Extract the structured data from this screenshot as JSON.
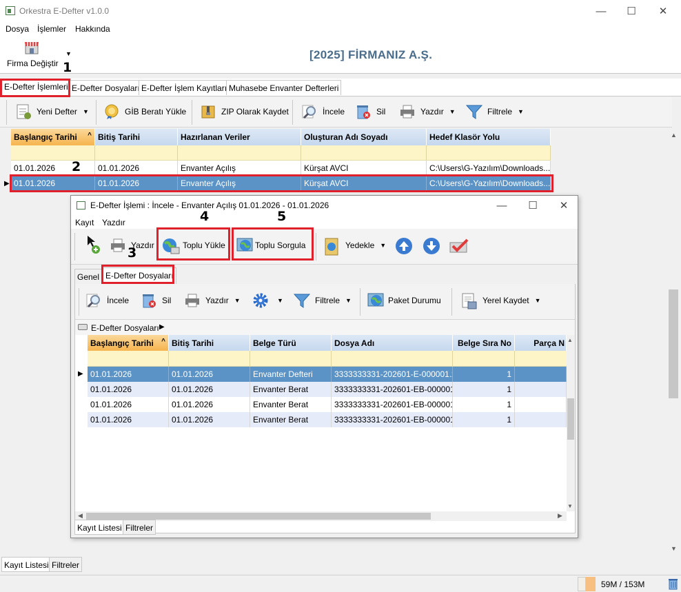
{
  "window": {
    "title": "Orkestra E-Defter v1.0.0",
    "min": "—",
    "max": "☐",
    "close": "✕"
  },
  "menu": [
    "Dosya",
    "İşlemler",
    "Hakkında"
  ],
  "company": {
    "switch_label": "Firma Değiştir",
    "name": "[2025] FİRMANIZ A.Ş."
  },
  "main_tabs": [
    "E-Defter İşlemleri",
    "E-Defter Dosyaları",
    "E-Defter İşlem Kayıtları",
    "Muhasebe Envanter Defterleri"
  ],
  "toolbar": {
    "new_ledger": "Yeni Defter",
    "gib_upload": "GİB Beratı Yükle",
    "zip_save": "ZIP Olarak Kaydet",
    "inspect": "İncele",
    "delete": "Sil",
    "print": "Yazdır",
    "filter": "Filtrele"
  },
  "main_grid": {
    "columns": [
      "Başlangıç Tarihi",
      "Bitiş Tarihi",
      "Hazırlanan Veriler",
      "Oluşturan Adı Soyadı",
      "Hedef Klasör Yolu"
    ],
    "rows": [
      [
        "01.01.2026",
        "01.01.2026",
        "Envanter Açılış",
        "Kürşat AVCI",
        "C:\\Users\\G-Yazılım\\Downloads..."
      ],
      [
        "01.01.2026",
        "01.01.2026",
        "Envanter Açılış",
        "Kürşat AVCI",
        "C:\\Users\\G-Yazılım\\Downloads..."
      ]
    ]
  },
  "bottom_tabs": [
    "Kayıt Listesi",
    "Filtreler"
  ],
  "status": {
    "memory": "59M / 153M"
  },
  "markers": [
    "1",
    "2",
    "3",
    "4",
    "5"
  ],
  "dialog": {
    "title": "E-Defter İşlemi : İncele - Envanter Açılış 01.01.2026 - 01.01.2026",
    "menu": [
      "Kayıt",
      "Yazdır"
    ],
    "toolbar": {
      "print": "Yazdır",
      "bulk_upload": "Toplu Yükle",
      "bulk_query": "Toplu Sorgula",
      "backup": "Yedekle"
    },
    "tabs": [
      "Genel",
      "E-Defter Dosyaları"
    ],
    "inner_toolbar": {
      "inspect": "İncele",
      "delete": "Sil",
      "print": "Yazdır",
      "filter": "Filtrele",
      "package_status": "Paket Durumu",
      "save_local": "Yerel Kaydet"
    },
    "breadcrumb": "E-Defter Dosyaları",
    "grid": {
      "columns": [
        "Başlangıç Tarihi",
        "Bitiş Tarihi",
        "Belge Türü",
        "Dosya Adı",
        "Belge Sıra No",
        "Parça N"
      ],
      "rows": [
        [
          "01.01.2026",
          "01.01.2026",
          "Envanter Defteri",
          "3333333331-202601-E-000001.x...",
          "1"
        ],
        [
          "01.01.2026",
          "01.01.2026",
          "Envanter Berat",
          "3333333331-202601-EB-000001...",
          "1"
        ],
        [
          "01.01.2026",
          "01.01.2026",
          "Envanter Berat",
          "3333333331-202601-EB-000001...",
          "1"
        ],
        [
          "01.01.2026",
          "01.01.2026",
          "Envanter Berat",
          "3333333331-202601-EB-000001...",
          "1"
        ]
      ]
    },
    "bottom_tabs": [
      "Kayıt Listesi",
      "Filtreler"
    ]
  }
}
